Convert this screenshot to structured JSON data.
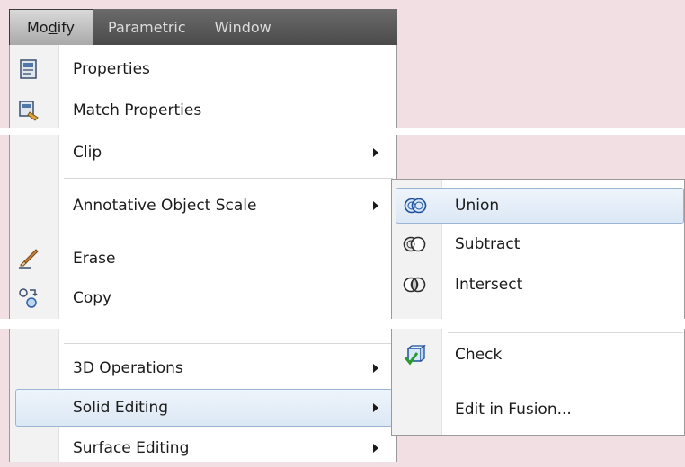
{
  "menubar": {
    "items": [
      {
        "prefix": "Mo",
        "underline": "d",
        "suffix": "ify"
      },
      {
        "label": "Parametric"
      },
      {
        "label": "Window"
      }
    ]
  },
  "dropdown": {
    "items": [
      {
        "label": "Properties",
        "icon": "properties-icon"
      },
      {
        "label": "Match Properties",
        "icon": "match-properties-icon"
      },
      {
        "label": "Clip",
        "submenu": true
      },
      {
        "label": "Annotative Object Scale",
        "submenu": true
      },
      {
        "label": "Erase",
        "icon": "erase-icon"
      },
      {
        "label": "Copy",
        "icon": "copy-icon"
      },
      {
        "label": "3D Operations",
        "submenu": true
      },
      {
        "label": "Solid Editing",
        "submenu": true,
        "highlighted": true
      },
      {
        "label": "Surface Editing",
        "submenu": true
      }
    ]
  },
  "submenu": {
    "items": [
      {
        "label": "Union",
        "icon": "union-icon",
        "highlighted": true
      },
      {
        "label": "Subtract",
        "icon": "subtract-icon"
      },
      {
        "label": "Intersect",
        "icon": "intersect-icon"
      },
      {
        "label": "Check",
        "icon": "check-icon"
      },
      {
        "label": "Edit in Fusion..."
      }
    ]
  },
  "colors": {
    "highlight_border": "#9ab4d2",
    "highlight_fill": "#dce8f5",
    "menubar_bg": "#4a4a4a",
    "page_bg": "#f1dfe3"
  }
}
